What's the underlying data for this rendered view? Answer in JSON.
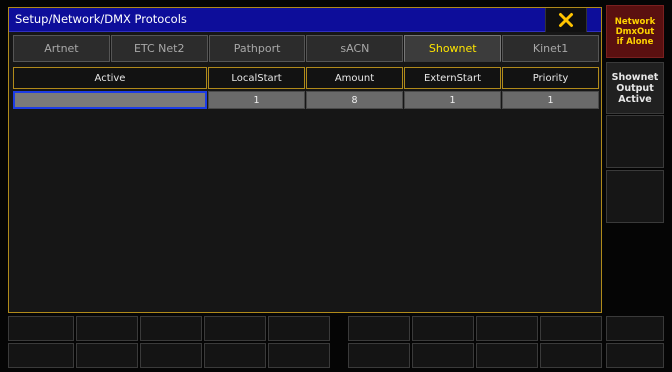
{
  "window": {
    "title": "Setup/Network/DMX Protocols"
  },
  "tabs": [
    {
      "label": "Artnet",
      "active": false
    },
    {
      "label": "ETC Net2",
      "active": false
    },
    {
      "label": "Pathport",
      "active": false
    },
    {
      "label": "sACN",
      "active": false
    },
    {
      "label": "Shownet",
      "active": true
    },
    {
      "label": "Kinet1",
      "active": false
    }
  ],
  "table": {
    "headers": [
      "Active",
      "LocalStart",
      "Amount",
      "ExternStart",
      "Priority"
    ],
    "rows": [
      [
        "",
        "1",
        "8",
        "1",
        "1"
      ]
    ]
  },
  "side_panel": {
    "network_button": "Network\nDmxOut\nif Alone",
    "shownet_button": "Shownet\nOutput\nActive"
  },
  "colors": {
    "title_bar": "#0d0d9a",
    "active_tab_text": "#ffe600",
    "window_border": "#b08a1a",
    "network_button_bg": "#5a1010",
    "network_button_text": "#ffd400",
    "selection_border": "#1c3ce6"
  },
  "icons": {
    "close": "close-x-icon"
  }
}
